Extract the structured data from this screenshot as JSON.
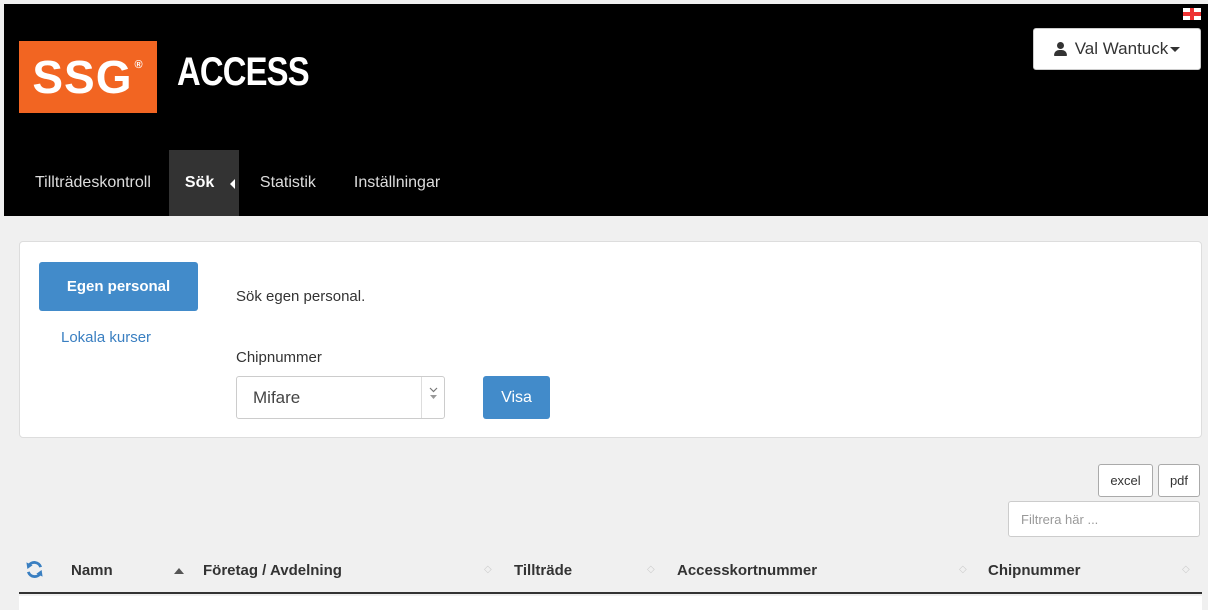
{
  "header": {
    "logo_text": "SSG",
    "logo_reg": "®",
    "brand": "ACCESS",
    "user_name": "Val Wantuck"
  },
  "nav": {
    "items": [
      {
        "label": "Tillträdeskontroll"
      },
      {
        "label": "Sök"
      },
      {
        "label": "Statistik"
      },
      {
        "label": "Inställningar"
      }
    ],
    "active_index": 1
  },
  "panel": {
    "primary_button": "Egen personal",
    "secondary_link": "Lokala kurser",
    "description": "Sök egen personal.",
    "chip_label": "Chipnummer",
    "chip_select_value": "Mifare",
    "show_button": "Visa"
  },
  "table_controls": {
    "excel_label": "excel",
    "pdf_label": "pdf",
    "filter_placeholder": "Filtrera här ..."
  },
  "table": {
    "columns": [
      "Namn",
      "Företag / Avdelning",
      "Tillträde",
      "Accesskortnummer",
      "Chipnummer"
    ]
  },
  "colors": {
    "brand_orange": "#f26522",
    "primary_blue": "#428bca",
    "header_bg": "#000000",
    "nav_active_bg": "#333333",
    "refresh_icon": "#3a7fc1"
  }
}
